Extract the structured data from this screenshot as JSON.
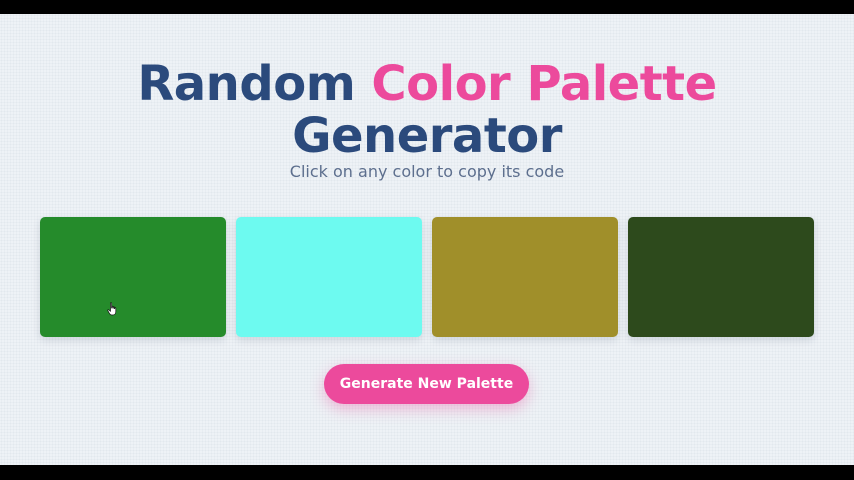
{
  "header": {
    "title_part1": "Random",
    "title_part2": "Color Palette",
    "title_part3": "Generator",
    "subtitle": "Click on any color to copy its code"
  },
  "palette": {
    "swatches": [
      {
        "color": "#258b2b"
      },
      {
        "color": "#6dfaf0"
      },
      {
        "color": "#a08f2a"
      },
      {
        "color": "#2d4a1c"
      }
    ]
  },
  "actions": {
    "generate_label": "Generate New Palette"
  },
  "theme": {
    "title_color": "#2b4a7c",
    "accent_color": "#ec4a9c",
    "subtitle_color": "#5d6f8e",
    "background": "#eef2f6"
  },
  "icons": {
    "cursor": "hand-pointer-icon"
  }
}
